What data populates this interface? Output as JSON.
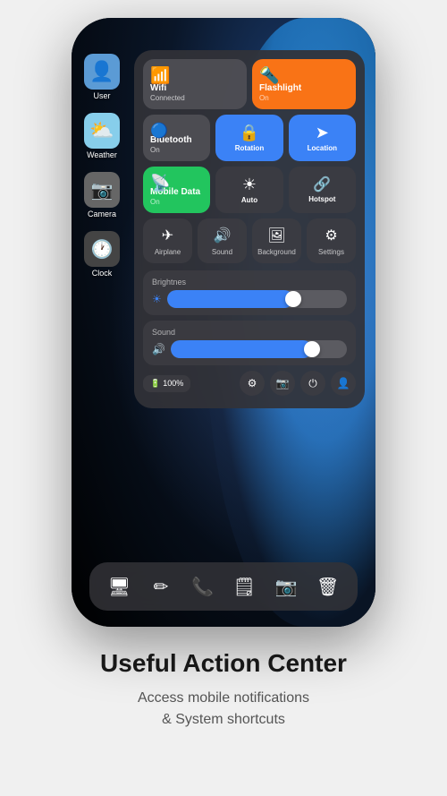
{
  "phone": {
    "apps": [
      {
        "id": "user",
        "label": "User",
        "icon": "👤",
        "bg": "#5b9bd5"
      },
      {
        "id": "weather",
        "label": "Weather",
        "icon": "⛅",
        "bg": "#87ceeb"
      },
      {
        "id": "camera",
        "label": "Camera",
        "icon": "📷",
        "bg": "#888"
      },
      {
        "id": "clock",
        "label": "Clock",
        "icon": "🕐",
        "bg": "#555"
      }
    ],
    "control_center": {
      "tiles": [
        {
          "id": "wifi",
          "label": "Wifi",
          "sub": "Connected",
          "icon": "📶",
          "color": "gray",
          "wide": true
        },
        {
          "id": "flashlight",
          "label": "Flashlight",
          "sub": "On",
          "icon": "🔦",
          "color": "orange",
          "wide": true
        },
        {
          "id": "bluetooth",
          "label": "Bluetooth",
          "sub": "On",
          "icon": "🔵",
          "color": "gray",
          "wide": true
        },
        {
          "id": "rotation",
          "label": "Rotation",
          "sub": "",
          "icon": "🔒",
          "color": "blue",
          "wide": false
        },
        {
          "id": "location",
          "label": "Location",
          "sub": "",
          "icon": "➤",
          "color": "blue",
          "wide": false
        },
        {
          "id": "mobile_data",
          "label": "Mobile Data",
          "sub": "On",
          "icon": "📡",
          "color": "green",
          "wide": true
        },
        {
          "id": "auto",
          "label": "Auto",
          "sub": "",
          "icon": "☀",
          "color": "dark",
          "wide": false
        },
        {
          "id": "hotspot",
          "label": "Hotspot",
          "sub": "",
          "icon": "🔗",
          "color": "dark",
          "wide": false
        }
      ],
      "bottom_icons": [
        {
          "id": "airplane",
          "label": "Airplane",
          "icon": "✈"
        },
        {
          "id": "sound",
          "label": "Sound",
          "icon": "🔊"
        },
        {
          "id": "background",
          "label": "Background",
          "icon": "🖼"
        },
        {
          "id": "settings",
          "label": "Settings",
          "icon": "⚙"
        }
      ],
      "sliders": [
        {
          "id": "brightness",
          "label": "Brightnes",
          "fill_pct": 70,
          "thumb_pct": 68
        },
        {
          "id": "sound",
          "label": "Sound",
          "fill_pct": 80,
          "thumb_pct": 78
        }
      ],
      "status": {
        "battery_icon": "🔋",
        "battery_pct": "100%",
        "icons": [
          "⚙",
          "📷",
          "⏻",
          "👤"
        ]
      }
    },
    "dock": {
      "icons": [
        "🖥",
        "✏",
        "📞",
        "🗒",
        "📷",
        "🗑"
      ]
    }
  },
  "page": {
    "title": "Useful Action Center",
    "subtitle": "Access mobile notifications\n& System shortcuts"
  }
}
